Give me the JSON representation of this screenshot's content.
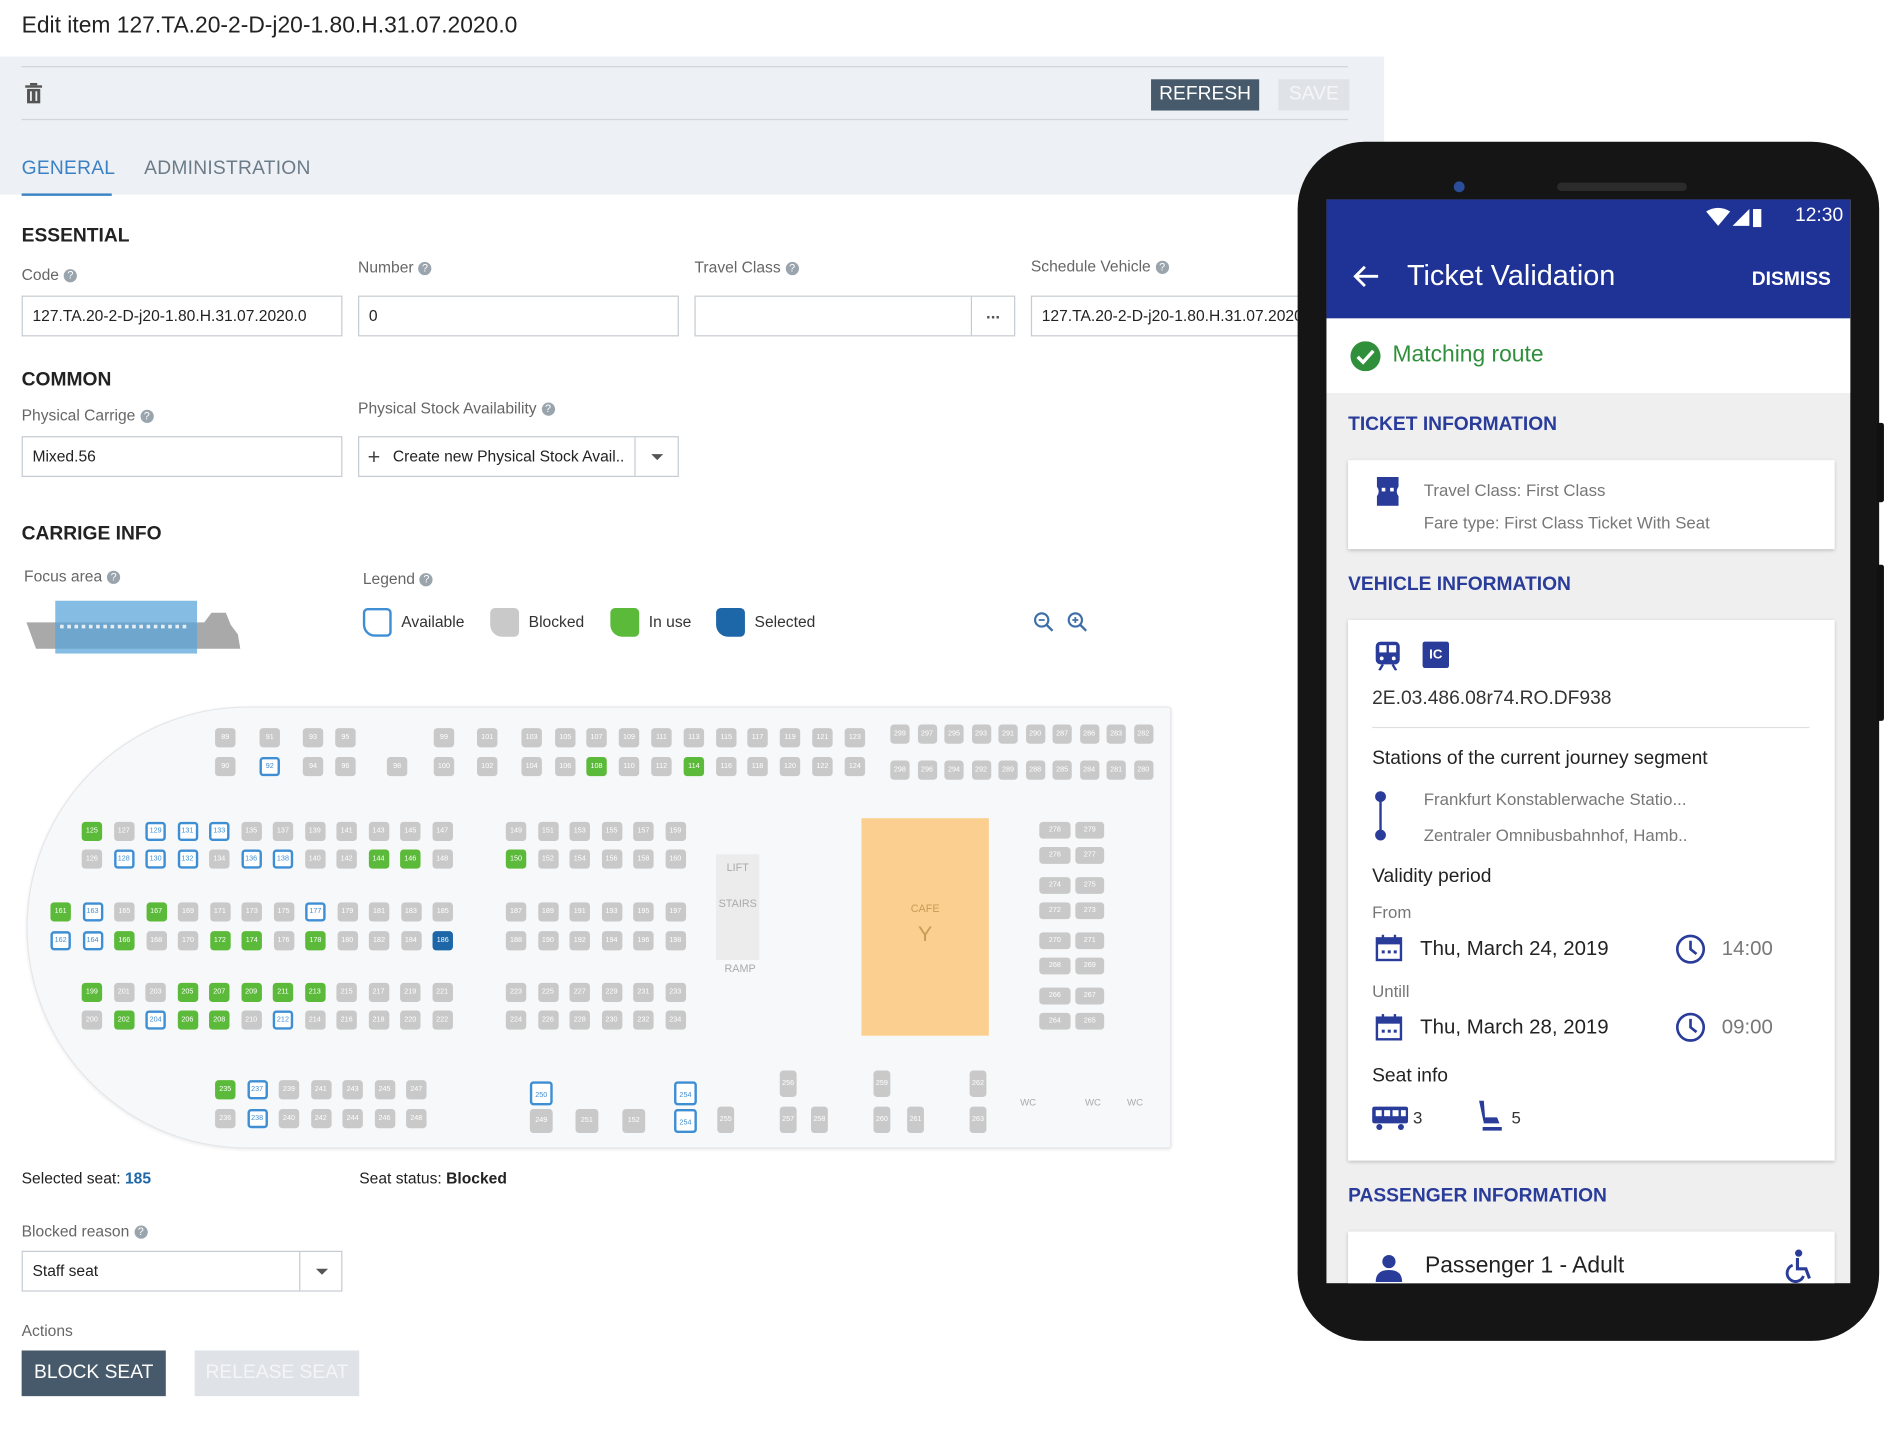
{
  "header": {
    "title": "Edit item 127.TA.20-2-D-j20-1.80.H.31.07.2020.0"
  },
  "toolbar": {
    "refresh_label": "REFRESH",
    "save_label": "SAVE"
  },
  "tabs": [
    {
      "label": "GENERAL",
      "active": true
    },
    {
      "label": "ADMINISTRATION",
      "active": false
    }
  ],
  "essential": {
    "heading": "ESSENTIAL",
    "code": {
      "label": "Code",
      "value": "127.TA.20-2-D-j20-1.80.H.31.07.2020.0"
    },
    "number": {
      "label": "Number",
      "value": "0"
    },
    "travel_class": {
      "label": "Travel Class",
      "value": "",
      "more": "..."
    },
    "schedule_vehicle": {
      "label": "Schedule Vehicle",
      "value": "127.TA.20-2-D-j20-1.80.H.31.07.2020.0"
    }
  },
  "common": {
    "heading": "COMMON",
    "physical_carriage": {
      "label": "Physical Carrige",
      "value": "Mixed.56"
    },
    "stock_availability": {
      "label": "Physical Stock Availability",
      "value": "Create new Physical Stock Avail.."
    }
  },
  "carriage_info": {
    "heading": "CARRIGE INFO",
    "focus_area_label": "Focus area",
    "legend_label": "Legend",
    "legend": [
      {
        "label": "Available",
        "color": "#3e8ed4"
      },
      {
        "label": "Blocked",
        "color": "#c9c9c9"
      },
      {
        "label": "In use",
        "color": "#5cba3a"
      },
      {
        "label": "Selected",
        "color": "#1d66a8"
      }
    ],
    "zoom_out_icon": "zoom-out-icon",
    "zoom_in_icon": "zoom-in-icon"
  },
  "seatmap": {
    "labels": {
      "lift": "LIFT",
      "stairs": "STAIRS",
      "ramp": "RAMP",
      "cafe": "CAFE",
      "wc": "WC"
    },
    "top_row_upper": [
      "89",
      "91",
      "93",
      "95",
      "",
      "99",
      "101",
      "103",
      "105",
      "107",
      "109",
      "111",
      "113",
      "115",
      "117",
      "119",
      "121",
      "123"
    ],
    "top_row_lower": [
      "90",
      "92",
      "94",
      "96",
      "98",
      "100",
      "102",
      "104",
      "106",
      "108",
      "110",
      "112",
      "114",
      "116",
      "118",
      "120",
      "122",
      "124"
    ],
    "top_right_upper": [
      "299",
      "297",
      "295",
      "293",
      "291",
      "290",
      "287",
      "286",
      "283",
      "282"
    ],
    "top_right_lower": [
      "298",
      "296",
      "294",
      "292",
      "289",
      "288",
      "285",
      "284",
      "281",
      "280"
    ],
    "block1_r1": [
      "125",
      "127",
      "129",
      "131",
      "133",
      "135",
      "137",
      "139",
      "141",
      "143",
      "145",
      "147"
    ],
    "block1_r2": [
      "126",
      "128",
      "130",
      "132",
      "134",
      "136",
      "138",
      "140",
      "142",
      "144",
      "146",
      "148"
    ],
    "block2_r1": [
      "149",
      "151",
      "153",
      "155",
      "157",
      "159"
    ],
    "block2_r2": [
      "150",
      "152",
      "154",
      "156",
      "158",
      "160"
    ],
    "block3_r1": [
      "161",
      "163",
      "165",
      "167",
      "169",
      "171",
      "173",
      "175",
      "177",
      "179",
      "181",
      "183",
      "185"
    ],
    "block3_r2": [
      "162",
      "164",
      "166",
      "168",
      "170",
      "172",
      "174",
      "176",
      "178",
      "180",
      "182",
      "184",
      "186"
    ],
    "block4_r1": [
      "187",
      "189",
      "191",
      "193",
      "195",
      "197"
    ],
    "block4_r2": [
      "188",
      "190",
      "192",
      "194",
      "196",
      "198"
    ],
    "block5_r1": [
      "199",
      "201",
      "203",
      "205",
      "207",
      "209",
      "211",
      "213",
      "215",
      "217",
      "219",
      "221"
    ],
    "block5_r2": [
      "200",
      "202",
      "204",
      "206",
      "208",
      "210",
      "212",
      "214",
      "216",
      "218",
      "220",
      "222"
    ],
    "block6_r1": [
      "223",
      "225",
      "227",
      "229",
      "231",
      "233"
    ],
    "block6_r2": [
      "224",
      "226",
      "228",
      "230",
      "232",
      "234"
    ],
    "bottom_r1": [
      "235",
      "237",
      "239",
      "241",
      "243",
      "245",
      "247"
    ],
    "bottom_r2": [
      "236",
      "238",
      "240",
      "242",
      "244",
      "246",
      "248"
    ],
    "accessible": [
      "250",
      "249",
      "251",
      "152",
      "254",
      "254"
    ],
    "right_pairs": [
      [
        "278",
        "279"
      ],
      [
        "276",
        "277"
      ],
      [
        "274",
        "275"
      ],
      [
        "272",
        "273"
      ],
      [
        "270",
        "271"
      ],
      [
        "268",
        "269"
      ],
      [
        "266",
        "267"
      ],
      [
        "264",
        "265"
      ]
    ],
    "bottom_right": [
      "255",
      "256",
      "257",
      "258",
      "259",
      "260",
      "261",
      "262",
      "263"
    ]
  },
  "selected": {
    "label": "Selected seat:",
    "value": "185",
    "status_label": "Seat status:",
    "status_value": "Blocked"
  },
  "blocked_reason": {
    "label": "Blocked reason",
    "value": "Staff seat"
  },
  "actions": {
    "label": "Actions",
    "block_label": "BLOCK SEAT",
    "release_label": "RELEASE SEAT"
  },
  "mobile": {
    "status_time": "12:30",
    "title": "Ticket Validation",
    "dismiss": "DISMISS",
    "match": "Matching route",
    "ticket_info_heading": "TICKET INFORMATION",
    "travel_class": "Travel Class: First Class",
    "fare_type": "Fare type: First Class Ticket With Seat",
    "vehicle_info_heading": "VEHICLE INFORMATION",
    "vehicle_badge": "IC",
    "vehicle_id": "2E.03.486.08r74.RO.DF938",
    "stations_title": "Stations of the current journey segment",
    "station_from": "Frankfurt Konstablerwache Statio...",
    "station_to": "Zentraler Omnibusbahnhof, Hamb..",
    "validity_title": "Validity period",
    "from_label": "From",
    "from_date": "Thu, March 24, 2019",
    "from_time": "14:00",
    "until_label": "Untill",
    "until_date": "Thu, March 28, 2019",
    "until_time": "09:00",
    "seat_info_title": "Seat info",
    "coach_count": "3",
    "seat_count": "5",
    "passenger_heading": "PASSENGER INFORMATION",
    "passenger": "Passenger 1 - Adult"
  }
}
